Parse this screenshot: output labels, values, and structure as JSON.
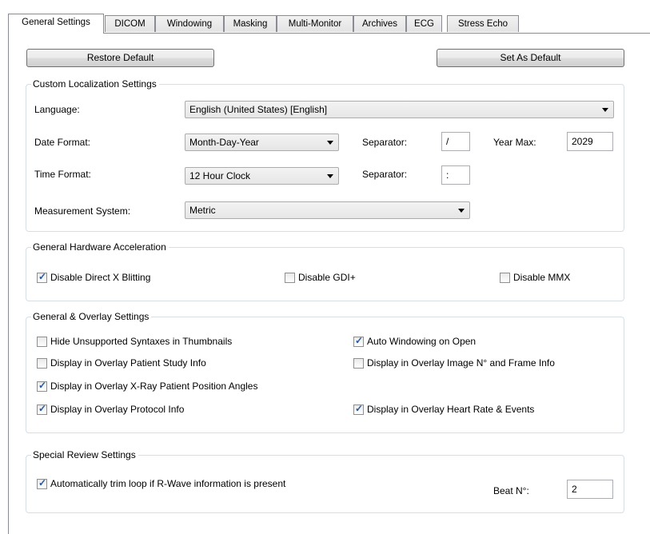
{
  "tabs": [
    "General Settings",
    "DICOM",
    "Windowing",
    "Masking",
    "Multi-Monitor",
    "Archives",
    "ECG",
    "Stress Echo"
  ],
  "buttons": {
    "restore_default": "Restore Default",
    "set_as_default": "Set As Default"
  },
  "localization": {
    "title": "Custom Localization Settings",
    "language_label": "Language:",
    "language_value": "English (United States)    [English]",
    "date_format_label": "Date Format:",
    "date_format_value": "Month-Day-Year",
    "date_separator_label": "Separator:",
    "date_separator_value": "/",
    "year_max_label": "Year Max:",
    "year_max_value": "2029",
    "time_format_label": "Time Format:",
    "time_format_value": "12 Hour Clock",
    "time_separator_label": "Separator:",
    "time_separator_value": ":",
    "measurement_label": "Measurement System:",
    "measurement_value": "Metric"
  },
  "hardware": {
    "title": "General Hardware Acceleration",
    "options": [
      {
        "label": "Disable Direct X Blitting",
        "checked": true
      },
      {
        "label": "Disable GDI+",
        "checked": false
      },
      {
        "label": "Disable MMX",
        "checked": false
      }
    ]
  },
  "overlay": {
    "title": "General & Overlay Settings",
    "options": [
      {
        "label": "Hide Unsupported Syntaxes in Thumbnails",
        "checked": false
      },
      {
        "label": "Auto Windowing on Open",
        "checked": true
      },
      {
        "label": "Display in Overlay Patient  Study Info",
        "checked": false
      },
      {
        "label": "Display in Overlay Image N° and Frame Info",
        "checked": false
      },
      {
        "label": "Display in Overlay X-Ray Patient Position Angles",
        "checked": true
      },
      {
        "label": "Display in Overlay Protocol Info",
        "checked": true
      },
      {
        "label": "Display in Overlay Heart Rate & Events",
        "checked": true
      }
    ]
  },
  "review": {
    "title": "Special Review Settings",
    "trim_label": "Automatically trim loop if R-Wave information is present",
    "trim_checked": true,
    "beat_label": "Beat N°:",
    "beat_value": "2"
  }
}
